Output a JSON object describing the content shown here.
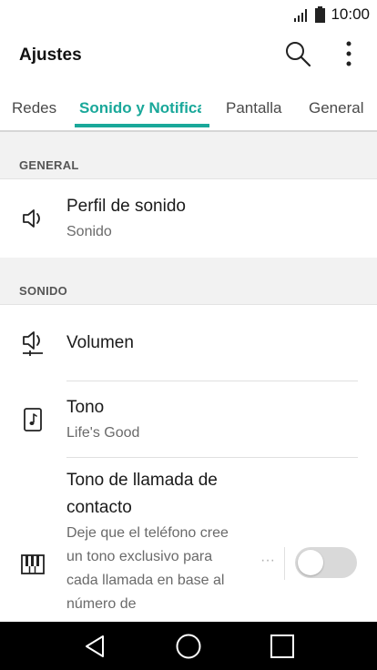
{
  "status_bar": {
    "time": "10:00",
    "signal_icon": "signal-icon",
    "battery_icon": "battery-icon"
  },
  "app_bar": {
    "title": "Ajustes",
    "search_icon": "search-icon",
    "more_icon": "more-vert-icon"
  },
  "tabs": [
    {
      "label": "Redes",
      "active": false
    },
    {
      "label": "Sonido y Notificaciones",
      "active": true
    },
    {
      "label": "Pantalla",
      "active": false
    },
    {
      "label": "General",
      "active": false
    }
  ],
  "sections": {
    "general": {
      "header": "GENERAL",
      "items": [
        {
          "title": "Perfil de sonido",
          "subtitle": "Sonido",
          "icon": "speaker-icon"
        }
      ]
    },
    "sonido": {
      "header": "SONIDO",
      "items": [
        {
          "title": "Volumen",
          "icon": "volume-icon"
        },
        {
          "title": "Tono",
          "subtitle": "Life's Good",
          "icon": "ringtone-icon"
        },
        {
          "title": "Tono de llamada de contacto",
          "subtitle": "Deje que el teléfono cree un tono exclusivo para cada llamada en base al número de",
          "icon": "piano-icon",
          "toggle_on": false
        }
      ]
    }
  },
  "colors": {
    "accent": "#1aa89a",
    "nav_bar": "#000000",
    "section_bg": "#f2f2f2"
  },
  "nav": {
    "back_icon": "back-icon",
    "home_icon": "home-icon",
    "recents_icon": "recents-icon"
  }
}
